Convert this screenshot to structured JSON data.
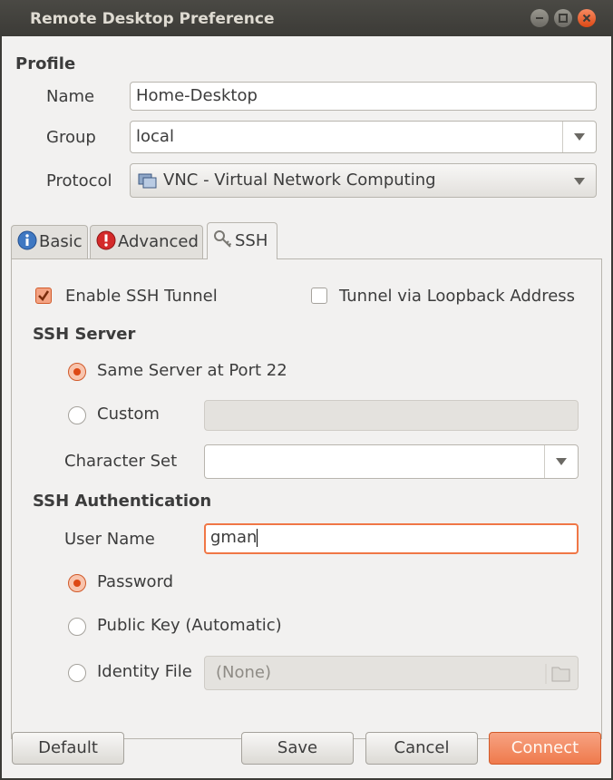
{
  "window": {
    "title": "Remote Desktop Preference"
  },
  "profile": {
    "heading": "Profile",
    "name_label": "Name",
    "name_value": "Home-Desktop",
    "group_label": "Group",
    "group_value": "local",
    "protocol_label": "Protocol",
    "protocol_value": "VNC - Virtual Network Computing",
    "protocol_icon": "monitor-icon"
  },
  "tabs": [
    {
      "label": "Basic",
      "icon": "info-icon"
    },
    {
      "label": "Advanced",
      "icon": "warning-icon"
    },
    {
      "label": "SSH",
      "icon": "keys-icon",
      "selected": true
    }
  ],
  "ssh": {
    "enable_tunnel_label": "Enable SSH Tunnel",
    "enable_tunnel_checked": true,
    "loopback_label": "Tunnel via Loopback Address",
    "loopback_checked": false,
    "server_heading": "SSH Server",
    "same_server_label": "Same Server at Port 22",
    "custom_label": "Custom",
    "custom_value": "",
    "charset_label": "Character Set",
    "charset_value": "",
    "auth_heading": "SSH Authentication",
    "username_label": "User Name",
    "username_value": "gman",
    "password_label": "Password",
    "pubkey_label": "Public Key (Automatic)",
    "identity_label": "Identity File",
    "identity_value": "(None)",
    "server_mode": "same",
    "auth_mode": "password"
  },
  "buttons": {
    "default": "Default",
    "save": "Save",
    "cancel": "Cancel",
    "connect": "Connect"
  },
  "colors": {
    "accent": "#dd4814",
    "titlebar": "#3c3b37",
    "background": "#f2f1f0"
  }
}
